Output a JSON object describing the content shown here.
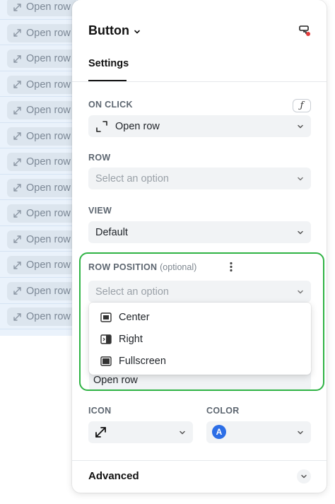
{
  "background_table": {
    "row_button_label": "Open row",
    "rows": [
      {
        "label": "Open row"
      },
      {
        "label": "Open row"
      },
      {
        "label": "Open row"
      },
      {
        "label": "Open row"
      },
      {
        "label": "Open row"
      },
      {
        "label": "Open row"
      },
      {
        "label": "Open row"
      },
      {
        "label": "Open row"
      },
      {
        "label": "Open row"
      },
      {
        "label": "Open row"
      },
      {
        "label": "Open row"
      },
      {
        "label": "Open row"
      },
      {
        "label": "Open row"
      }
    ]
  },
  "panel": {
    "title": "Button",
    "header_icon": "paint-format-icon",
    "tabs": [
      {
        "label": "Settings",
        "active": true
      }
    ],
    "on_click": {
      "label": "ON CLICK",
      "fx_label": "ƒ",
      "value": "Open row",
      "icon": "expand-diagonal-icon"
    },
    "row": {
      "label": "ROW",
      "placeholder": "Select an option"
    },
    "view": {
      "label": "VIEW",
      "value": "Default"
    },
    "row_position": {
      "label": "ROW POSITION",
      "optional": "(optional)",
      "placeholder": "Select an option",
      "options": [
        {
          "label": "Center",
          "icon": "center-layout-icon"
        },
        {
          "label": "Right",
          "icon": "right-panel-icon"
        },
        {
          "label": "Fullscreen",
          "icon": "fullscreen-layout-icon"
        }
      ]
    },
    "text": {
      "value": "Open row"
    },
    "icon_field": {
      "label": "ICON",
      "value_icon": "expand-diagonal-icon"
    },
    "color_field": {
      "label": "COLOR",
      "badge": "A",
      "badge_color": "#2c6ee6"
    },
    "advanced": {
      "label": "Advanced"
    }
  },
  "colors": {
    "highlight_border": "#2fb344",
    "table_bg": "#eaf2fb"
  }
}
